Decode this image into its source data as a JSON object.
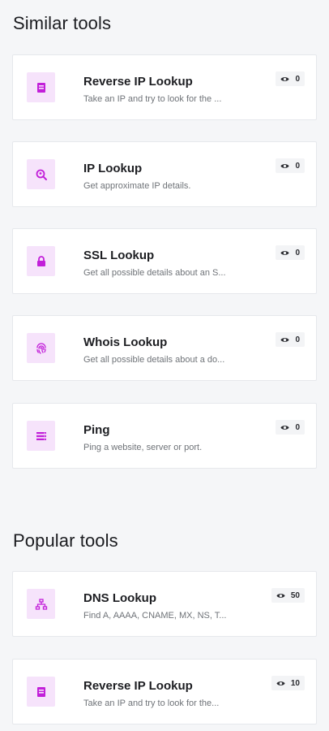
{
  "similar": {
    "title": "Similar tools",
    "tools": [
      {
        "name": "Reverse IP Lookup",
        "desc": "Take an IP and try to look for the ...",
        "views": "0",
        "icon": "address-card-icon"
      },
      {
        "name": "IP Lookup",
        "desc": "Get approximate IP details.",
        "views": "0",
        "icon": "search-location-icon"
      },
      {
        "name": "SSL Lookup",
        "desc": "Get all possible details about an S...",
        "views": "0",
        "icon": "lock-icon"
      },
      {
        "name": "Whois Lookup",
        "desc": "Get all possible details about a do...",
        "views": "0",
        "icon": "fingerprint-icon"
      },
      {
        "name": "Ping",
        "desc": "Ping a website, server or port.",
        "views": "0",
        "icon": "server-icon"
      }
    ]
  },
  "popular": {
    "title": "Popular tools",
    "tools": [
      {
        "name": "DNS Lookup",
        "desc": "Find A, AAAA, CNAME, MX, NS, T...",
        "views": "50",
        "icon": "network-icon"
      },
      {
        "name": "Reverse IP Lookup",
        "desc": "Take an IP and try to look for the...",
        "views": "10",
        "icon": "address-card-icon"
      }
    ]
  },
  "colors": {
    "accent": "#c21fd9",
    "icon_bg": "#f6e3fb",
    "card_bg": "#ffffff",
    "page_bg": "#f5f6f8"
  }
}
